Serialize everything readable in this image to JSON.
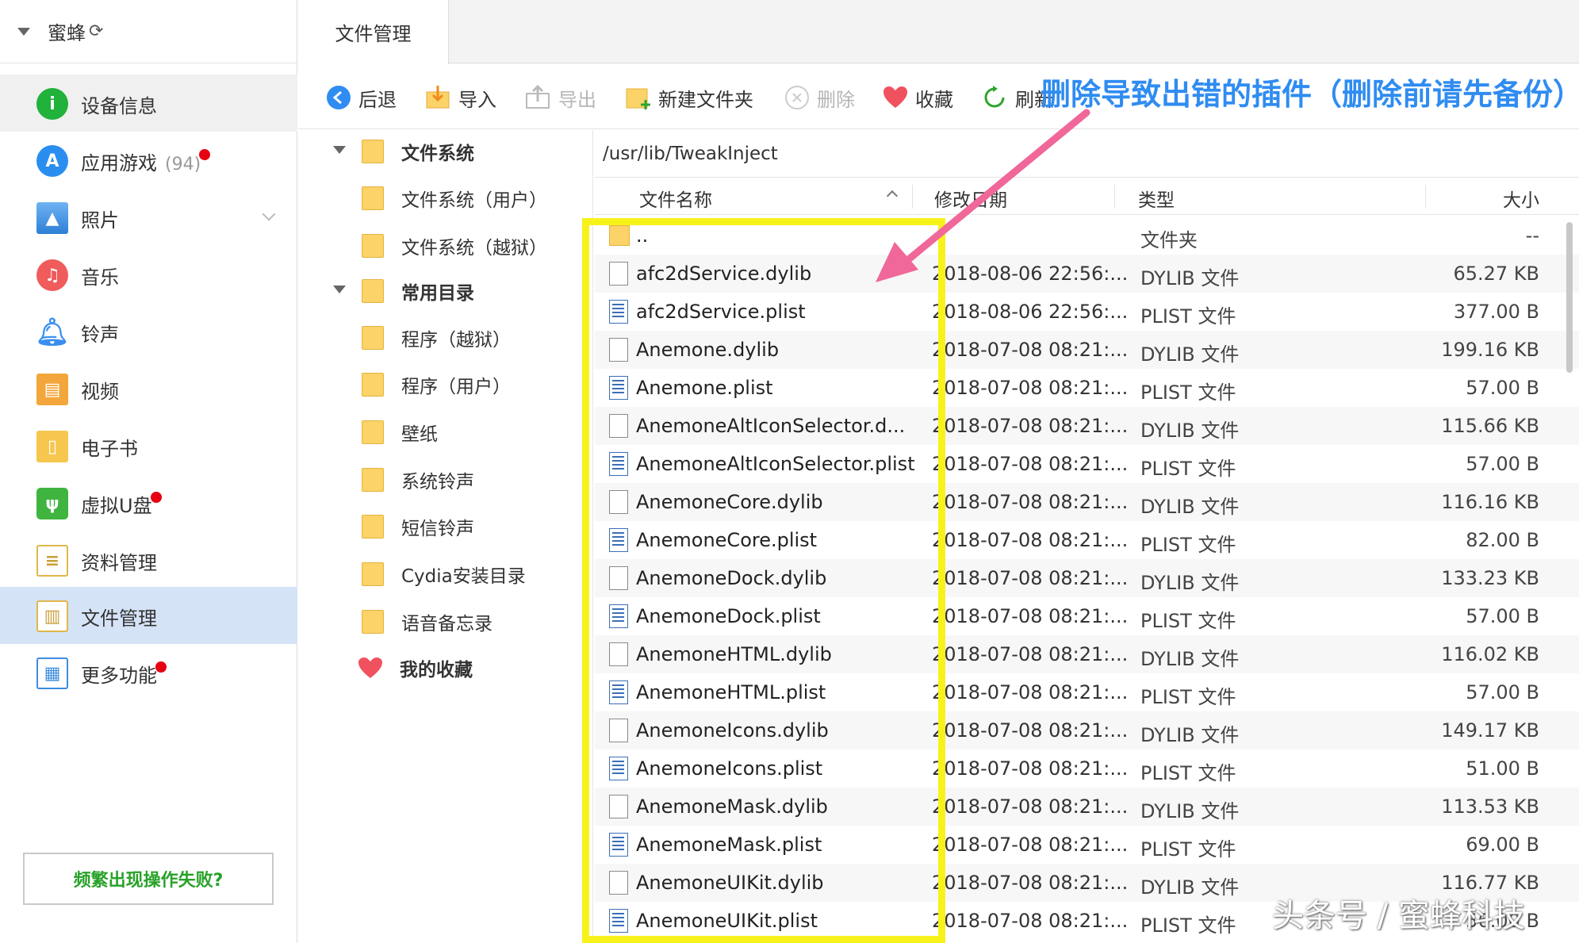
{
  "sidebar": {
    "device_name": "蜜蜂",
    "items": [
      {
        "label": "设备信息",
        "icon": "info-icon",
        "count": "",
        "dot": false
      },
      {
        "label": "应用游戏",
        "icon": "app-store-icon",
        "count": "(94)",
        "dot": true
      },
      {
        "label": "照片",
        "icon": "photo-icon",
        "count": "",
        "dot": false
      },
      {
        "label": "音乐",
        "icon": "music-icon",
        "count": "",
        "dot": false
      },
      {
        "label": "铃声",
        "icon": "bell-icon",
        "count": "",
        "dot": false
      },
      {
        "label": "视频",
        "icon": "video-icon",
        "count": "",
        "dot": false
      },
      {
        "label": "电子书",
        "icon": "book-icon",
        "count": "",
        "dot": false
      },
      {
        "label": "虚拟U盘",
        "icon": "usb-icon",
        "count": "",
        "dot": true
      },
      {
        "label": "资料管理",
        "icon": "contacts-icon",
        "count": "",
        "dot": false
      },
      {
        "label": "文件管理",
        "icon": "files-icon",
        "count": "",
        "dot": false
      },
      {
        "label": "更多功能",
        "icon": "apps-grid-icon",
        "count": "",
        "dot": true
      }
    ],
    "help_text": "频繁出现操作失败?"
  },
  "tab": {
    "label": "文件管理"
  },
  "toolbar": {
    "back": "后退",
    "import": "导入",
    "export": "导出",
    "new_folder": "新建文件夹",
    "delete": "删除",
    "favorite": "收藏",
    "refresh": "刷新"
  },
  "tree": {
    "file_system": "文件系统",
    "fs_user": "文件系统（用户）",
    "fs_jailbreak": "文件系统（越狱）",
    "common_dirs": "常用目录",
    "apps_jailbreak": "程序（越狱）",
    "apps_user": "程序（用户）",
    "wallpaper": "壁纸",
    "system_ringtones": "系统铃声",
    "sms_ringtones": "短信铃声",
    "cydia_dir": "Cydia安装目录",
    "voice_memos": "语音备忘录",
    "favorites": "我的收藏"
  },
  "path": "/usr/lib/TweakInject",
  "columns": {
    "name": "文件名称",
    "modified": "修改日期",
    "type": "类型",
    "size": "大小"
  },
  "files": [
    {
      "name": "..",
      "date": "",
      "type": "文件夹",
      "size": "--",
      "kind": "folder"
    },
    {
      "name": "afc2dService.dylib",
      "date": "2018-08-06 22:56:...",
      "type": "DYLIB 文件",
      "size": "65.27 KB",
      "kind": "doc"
    },
    {
      "name": "afc2dService.plist",
      "date": "2018-08-06 22:56:...",
      "type": "PLIST 文件",
      "size": "377.00 B",
      "kind": "plist"
    },
    {
      "name": "Anemone.dylib",
      "date": "2018-07-08 08:21:...",
      "type": "DYLIB 文件",
      "size": "199.16 KB",
      "kind": "doc"
    },
    {
      "name": "Anemone.plist",
      "date": "2018-07-08 08:21:...",
      "type": "PLIST 文件",
      "size": "57.00 B",
      "kind": "plist"
    },
    {
      "name": "AnemoneAltIconSelector.d...",
      "date": "2018-07-08 08:21:...",
      "type": "DYLIB 文件",
      "size": "115.66 KB",
      "kind": "doc"
    },
    {
      "name": "AnemoneAltIconSelector.plist",
      "date": "2018-07-08 08:21:...",
      "type": "PLIST 文件",
      "size": "57.00 B",
      "kind": "plist"
    },
    {
      "name": "AnemoneCore.dylib",
      "date": "2018-07-08 08:21:...",
      "type": "DYLIB 文件",
      "size": "116.16 KB",
      "kind": "doc"
    },
    {
      "name": "AnemoneCore.plist",
      "date": "2018-07-08 08:21:...",
      "type": "PLIST 文件",
      "size": "82.00 B",
      "kind": "plist"
    },
    {
      "name": "AnemoneDock.dylib",
      "date": "2018-07-08 08:21:...",
      "type": "DYLIB 文件",
      "size": "133.23 KB",
      "kind": "doc"
    },
    {
      "name": "AnemoneDock.plist",
      "date": "2018-07-08 08:21:...",
      "type": "PLIST 文件",
      "size": "57.00 B",
      "kind": "plist"
    },
    {
      "name": "AnemoneHTML.dylib",
      "date": "2018-07-08 08:21:...",
      "type": "DYLIB 文件",
      "size": "116.02 KB",
      "kind": "doc"
    },
    {
      "name": "AnemoneHTML.plist",
      "date": "2018-07-08 08:21:...",
      "type": "PLIST 文件",
      "size": "57.00 B",
      "kind": "plist"
    },
    {
      "name": "AnemoneIcons.dylib",
      "date": "2018-07-08 08:21:...",
      "type": "DYLIB 文件",
      "size": "149.17 KB",
      "kind": "doc"
    },
    {
      "name": "AnemoneIcons.plist",
      "date": "2018-07-08 08:21:...",
      "type": "PLIST 文件",
      "size": "51.00 B",
      "kind": "plist"
    },
    {
      "name": "AnemoneMask.dylib",
      "date": "2018-07-08 08:21:...",
      "type": "DYLIB 文件",
      "size": "113.53 KB",
      "kind": "doc"
    },
    {
      "name": "AnemoneMask.plist",
      "date": "2018-07-08 08:21:...",
      "type": "PLIST 文件",
      "size": "69.00 B",
      "kind": "plist"
    },
    {
      "name": "AnemoneUIKit.dylib",
      "date": "2018-07-08 08:21:...",
      "type": "DYLIB 文件",
      "size": "116.77 KB",
      "kind": "doc"
    },
    {
      "name": "AnemoneUIKit.plist",
      "date": "2018-07-08 08:21:...",
      "type": "PLIST 文件",
      "size": "56.00 B",
      "kind": "plist"
    }
  ],
  "annotation": {
    "text": "删除导致出错的插件（删除前请先备份）",
    "color": "#2f8cf1",
    "arrow_color": "#f0679a",
    "highlight_color": "#f8f21b"
  },
  "watermark": "头条号 / 蜜蜂科技"
}
